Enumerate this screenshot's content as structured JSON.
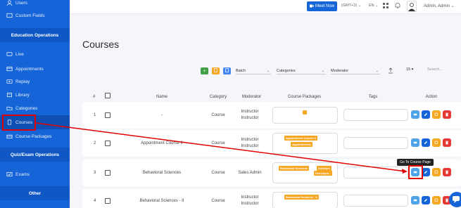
{
  "sidebar": {
    "top_items": [
      {
        "label": "Users",
        "icon": "users-icon"
      },
      {
        "label": "Custom Fields",
        "icon": "custom-fields-icon"
      }
    ],
    "section_education": "Education Operations",
    "education_items": [
      {
        "label": "Live",
        "icon": "live-icon"
      },
      {
        "label": "Appointments",
        "icon": "appointments-icon"
      },
      {
        "label": "Replay",
        "icon": "replay-icon"
      },
      {
        "label": "Library",
        "icon": "library-icon"
      },
      {
        "label": "Categories",
        "icon": "categories-icon"
      },
      {
        "label": "Courses",
        "icon": "courses-icon"
      },
      {
        "label": "Course Packages",
        "icon": "course-packages-icon"
      }
    ],
    "section_quiz": "Quiz/Exam Operations",
    "quiz_items": [
      {
        "label": "Exams",
        "icon": "exams-icon"
      }
    ],
    "section_other": "Other"
  },
  "topbar": {
    "meet_now": "Meet Now",
    "timezone": "(GMT+3) ⌄",
    "language": "EN ⌄",
    "user": "Admin, Admin ⌄"
  },
  "page": {
    "title": "Courses"
  },
  "toolbar": {
    "batch": "Batch",
    "categories": "Categories",
    "moderator": "Moderator",
    "page_size": "15 ▾",
    "search_placeholder": "Search..."
  },
  "table": {
    "headers": [
      "#",
      "Name",
      "Category",
      "Moderator",
      "Course Packages",
      "Tags",
      "Action"
    ],
    "rows": [
      {
        "num": "1",
        "name": "-",
        "category": "Course",
        "moderator": [
          "Instructor",
          "Instructor"
        ],
        "packages": [
          ""
        ]
      },
      {
        "num": "2",
        "name": "Appointment Course II",
        "category": "Course",
        "moderator": [
          "Instructor",
          "Instructor"
        ],
        "packages": [
          "Appointment Course II",
          "Appointments"
        ]
      },
      {
        "num": "3",
        "name": "Behavioral Sciences",
        "category": "Course",
        "moderator": [
          "Sales Admin"
        ],
        "packages": [
          "Behavioral Sciences",
          "Software",
          "Developm..."
        ]
      },
      {
        "num": "4",
        "name": "Behavioral Sciences - II",
        "category": "Course",
        "moderator": [
          "Instructor",
          "Instructor"
        ],
        "packages": [
          "Behavioral Sciences - II"
        ]
      }
    ]
  },
  "tooltip": "Go To Course Page",
  "colors": {
    "sidebar": "#1565d8",
    "accent_orange": "#f5a623",
    "delete_red": "#e53935",
    "annotation_red": "#e00000"
  }
}
